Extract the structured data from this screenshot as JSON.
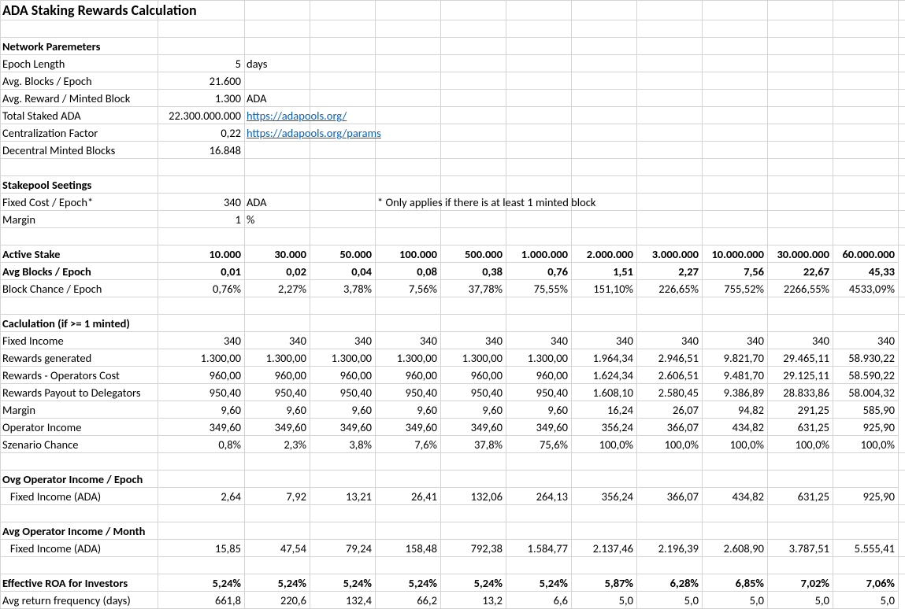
{
  "title": "ADA Staking Rewards Calculation",
  "network": {
    "header": "Network Paremeters",
    "rows": [
      {
        "label": "Epoch Length",
        "value": "5",
        "unit": "days"
      },
      {
        "label": "Avg. Blocks / Epoch",
        "value": "21.600",
        "unit": ""
      },
      {
        "label": "Avg. Reward / Minted Block",
        "value": "1.300",
        "unit": "ADA"
      },
      {
        "label": "Total Staked ADA",
        "value": "22.300.000.000",
        "link": "https://adapools.org/"
      },
      {
        "label": "Centralization Factor",
        "value": "0,22",
        "link": "https://adapools.org/params"
      },
      {
        "label": "Decentral Minted Blocks",
        "value": "16.848",
        "unit": ""
      }
    ]
  },
  "stakepool": {
    "header": "Stakepool Seetings",
    "rows": [
      {
        "label": "Fixed Cost / Epoch*",
        "value": "340",
        "unit": "ADA",
        "note": "* Only applies if there is at least 1 minted block"
      },
      {
        "label": "Margin",
        "value": "1",
        "unit": "%"
      }
    ]
  },
  "activeStakeHeader": "Active Stake",
  "stakes": [
    "10.000",
    "30.000",
    "50.000",
    "100.000",
    "500.000",
    "1.000.000",
    "2.000.000",
    "3.000.000",
    "10.000.000",
    "30.000.000",
    "60.000.000"
  ],
  "rows": [
    {
      "label": "Avg Blocks / Epoch",
      "bold": true,
      "vals": [
        "0,01",
        "0,02",
        "0,04",
        "0,08",
        "0,38",
        "0,76",
        "1,51",
        "2,27",
        "7,56",
        "22,67",
        "45,33"
      ]
    },
    {
      "label": "Block Chance / Epoch",
      "vals": [
        "0,76%",
        "2,27%",
        "3,78%",
        "7,56%",
        "37,78%",
        "75,55%",
        "151,10%",
        "226,65%",
        "755,52%",
        "2266,55%",
        "4533,09%"
      ]
    },
    {
      "blank": true
    },
    {
      "label": "Caclulation (if >= 1 minted)",
      "bold": true,
      "vals": []
    },
    {
      "label": "Fixed Income",
      "vals": [
        "340",
        "340",
        "340",
        "340",
        "340",
        "340",
        "340",
        "340",
        "340",
        "340",
        "340"
      ]
    },
    {
      "label": "Rewards generated",
      "vals": [
        "1.300,00",
        "1.300,00",
        "1.300,00",
        "1.300,00",
        "1.300,00",
        "1.300,00",
        "1.964,34",
        "2.946,51",
        "9.821,70",
        "29.465,11",
        "58.930,22"
      ]
    },
    {
      "label": "Rewards - Operators Cost",
      "vals": [
        "960,00",
        "960,00",
        "960,00",
        "960,00",
        "960,00",
        "960,00",
        "1.624,34",
        "2.606,51",
        "9.481,70",
        "29.125,11",
        "58.590,22"
      ]
    },
    {
      "label": "Rewards Payout to Delegators",
      "vals": [
        "950,40",
        "950,40",
        "950,40",
        "950,40",
        "950,40",
        "950,40",
        "1.608,10",
        "2.580,45",
        "9.386,89",
        "28.833,86",
        "58.004,32"
      ]
    },
    {
      "label": "Margin",
      "vals": [
        "9,60",
        "9,60",
        "9,60",
        "9,60",
        "9,60",
        "9,60",
        "16,24",
        "26,07",
        "94,82",
        "291,25",
        "585,90"
      ]
    },
    {
      "label": "Operator Income",
      "vals": [
        "349,60",
        "349,60",
        "349,60",
        "349,60",
        "349,60",
        "349,60",
        "356,24",
        "366,07",
        "434,82",
        "631,25",
        "925,90"
      ]
    },
    {
      "label": "Szenario Chance",
      "vals": [
        "0,8%",
        "2,3%",
        "3,8%",
        "7,6%",
        "37,8%",
        "75,6%",
        "100,0%",
        "100,0%",
        "100,0%",
        "100,0%",
        "100,0%"
      ]
    },
    {
      "blank": true
    },
    {
      "label": "Ovg Operator Income / Epoch",
      "bold": true,
      "vals": []
    },
    {
      "label": "   Fixed Income (ADA)",
      "vals": [
        "2,64",
        "7,92",
        "13,21",
        "26,41",
        "132,06",
        "264,13",
        "356,24",
        "366,07",
        "434,82",
        "631,25",
        "925,90"
      ]
    },
    {
      "blank": true
    },
    {
      "label": "Avg Operator Income / Month",
      "bold": true,
      "vals": []
    },
    {
      "label": "   Fixed Income (ADA)",
      "vals": [
        "15,85",
        "47,54",
        "79,24",
        "158,48",
        "792,38",
        "1.584,77",
        "2.137,46",
        "2.196,39",
        "2.608,90",
        "3.787,51",
        "5.555,41"
      ]
    },
    {
      "blank": true
    },
    {
      "label": "Effective ROA for Investors",
      "bold": true,
      "vals": [
        "5,24%",
        "5,24%",
        "5,24%",
        "5,24%",
        "5,24%",
        "5,24%",
        "5,87%",
        "6,28%",
        "6,85%",
        "7,02%",
        "7,06%"
      ]
    },
    {
      "label": "Avg return frequency (days)",
      "vals": [
        "661,8",
        "220,6",
        "132,4",
        "66,2",
        "13,2",
        "6,6",
        "5,0",
        "5,0",
        "5,0",
        "5,0",
        "5,0"
      ]
    }
  ]
}
